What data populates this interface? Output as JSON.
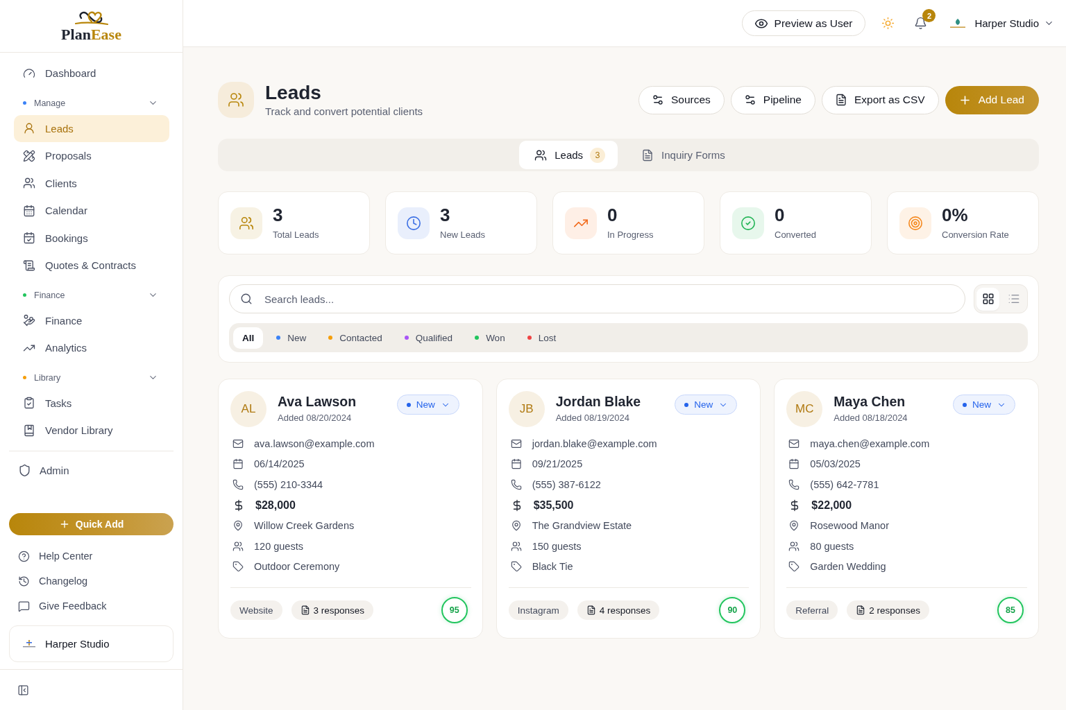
{
  "sidebar": {
    "brand": {
      "name": "Plan",
      "name_accent": "Ease"
    },
    "nav": [
      {
        "kind": "link",
        "label": "Dashboard",
        "selected": false
      },
      {
        "kind": "section",
        "label": "Manage",
        "color": "#3b82f6",
        "expanded": true,
        "children": [
          {
            "label": "Leads",
            "selected": true
          },
          {
            "label": "Proposals",
            "selected": false
          },
          {
            "label": "Clients",
            "selected": false
          },
          {
            "label": "Calendar",
            "selected": false
          },
          {
            "label": "Bookings",
            "selected": false
          },
          {
            "label": "Quotes & Contracts",
            "selected": false
          }
        ]
      },
      {
        "kind": "section",
        "label": "Finance",
        "color": "#22c55e",
        "expanded": true,
        "children": [
          {
            "label": "Finance",
            "selected": false
          },
          {
            "label": "Analytics",
            "selected": false
          }
        ]
      },
      {
        "kind": "section",
        "label": "Library",
        "color": "#f59e0b",
        "expanded": true,
        "children": [
          {
            "label": "Tasks",
            "selected": false
          },
          {
            "label": "Vendor Library",
            "selected": false
          }
        ]
      }
    ],
    "admin": {
      "label": "Admin",
      "selected": false
    },
    "quick_add": "Quick Add",
    "help_links": [
      "Help Center",
      "Changelog",
      "Give Feedback"
    ],
    "workspace": {
      "name": "Harper Studio"
    }
  },
  "topbar": {
    "preview_button": "Preview as User",
    "notifications": {
      "count": "2"
    },
    "account": {
      "name": "Harper Studio"
    }
  },
  "page": {
    "title": "Leads",
    "subtitle": "Track and convert potential clients",
    "actions": [
      {
        "kind": "secondary",
        "label": "Sources"
      },
      {
        "kind": "secondary",
        "label": "Pipeline"
      },
      {
        "kind": "secondary",
        "label": "Export as CSV"
      },
      {
        "kind": "primary",
        "label": "Add Lead"
      }
    ]
  },
  "tabs": [
    {
      "label": "Leads",
      "count": "3",
      "selected": true
    },
    {
      "label": "Inquiry Forms",
      "selected": false
    }
  ],
  "stats": [
    {
      "value": "3",
      "label": "Total Leads",
      "color": "#b8860b"
    },
    {
      "value": "3",
      "label": "New Leads",
      "color": "#3b6fe4"
    },
    {
      "value": "0",
      "label": "In Progress",
      "color": "#f26b1d"
    },
    {
      "value": "0",
      "label": "Converted",
      "color": "#22b455"
    },
    {
      "value": "0%",
      "label": "Conversion Rate",
      "color": "#f5891f"
    }
  ],
  "filters": {
    "search": {
      "placeholder": "Search leads..."
    },
    "view_modes": [
      {
        "selected": true
      },
      {
        "selected": false
      }
    ],
    "statuses": [
      {
        "label": "All",
        "selected": true
      },
      {
        "label": "New",
        "color": "#3b82f6",
        "selected": false
      },
      {
        "label": "Contacted",
        "color": "#f59e0b",
        "selected": false
      },
      {
        "label": "Qualified",
        "color": "#a855f7",
        "selected": false
      },
      {
        "label": "Won",
        "color": "#22c55e",
        "selected": false
      },
      {
        "label": "Lost",
        "color": "#ef4444",
        "selected": false
      }
    ]
  },
  "leads": [
    {
      "initials": "AL",
      "name": "Ava Lawson",
      "added": "Added 08/20/2024",
      "status": {
        "label": "New",
        "color": "#2563eb"
      },
      "details": [
        {
          "kind": "email",
          "text": "ava.lawson@example.com"
        },
        {
          "kind": "date",
          "text": "06/14/2025"
        },
        {
          "kind": "phone",
          "text": "(555) 210-3344"
        },
        {
          "kind": "amount",
          "text": "$28,000"
        },
        {
          "kind": "venue",
          "text": "Willow Creek Gardens"
        },
        {
          "kind": "guests",
          "text": "120 guests"
        },
        {
          "kind": "style",
          "text": "Outdoor Ceremony"
        }
      ],
      "source": "Website",
      "responses": "3 responses",
      "score": "95"
    },
    {
      "initials": "JB",
      "name": "Jordan Blake",
      "added": "Added 08/19/2024",
      "status": {
        "label": "New",
        "color": "#2563eb"
      },
      "details": [
        {
          "kind": "email",
          "text": "jordan.blake@example.com"
        },
        {
          "kind": "date",
          "text": "09/21/2025"
        },
        {
          "kind": "phone",
          "text": "(555) 387-6122"
        },
        {
          "kind": "amount",
          "text": "$35,500"
        },
        {
          "kind": "venue",
          "text": "The Grandview Estate"
        },
        {
          "kind": "guests",
          "text": "150 guests"
        },
        {
          "kind": "style",
          "text": "Black Tie"
        }
      ],
      "source": "Instagram",
      "responses": "4 responses",
      "score": "90"
    },
    {
      "initials": "MC",
      "name": "Maya Chen",
      "added": "Added 08/18/2024",
      "status": {
        "label": "New",
        "color": "#2563eb"
      },
      "details": [
        {
          "kind": "email",
          "text": "maya.chen@example.com"
        },
        {
          "kind": "date",
          "text": "05/03/2025"
        },
        {
          "kind": "phone",
          "text": "(555) 642-7781"
        },
        {
          "kind": "amount",
          "text": "$22,000"
        },
        {
          "kind": "venue",
          "text": "Rosewood Manor"
        },
        {
          "kind": "guests",
          "text": "80 guests"
        },
        {
          "kind": "style",
          "text": "Garden Wedding"
        }
      ],
      "source": "Referral",
      "responses": "2 responses",
      "score": "85"
    }
  ]
}
